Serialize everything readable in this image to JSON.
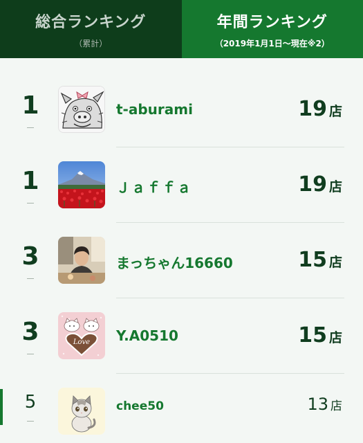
{
  "tabs": {
    "total": {
      "title": "総合ランキング",
      "sub": "（累計）"
    },
    "annual": {
      "title": "年間ランキング",
      "sub": "（2019年1月1日〜現在※2）"
    }
  },
  "ranking": [
    {
      "rank": "1",
      "name": "t-aburami",
      "count": "19",
      "unit": "店",
      "avatar": "pig-manga-icon"
    },
    {
      "rank": "1",
      "name": "Ｊａｆｆａ",
      "count": "19",
      "unit": "店",
      "avatar": "mountain-tulips-photo"
    },
    {
      "rank": "3",
      "name": "まっちゃん16660",
      "count": "15",
      "unit": "店",
      "avatar": "person-photo"
    },
    {
      "rank": "3",
      "name": "Y.A0510",
      "count": "15",
      "unit": "店",
      "avatar": "love-heart-cats-icon"
    },
    {
      "rank": "5",
      "name": "chee50",
      "count": "13",
      "unit": "店",
      "avatar": "kitten-cartoon-icon"
    }
  ]
}
